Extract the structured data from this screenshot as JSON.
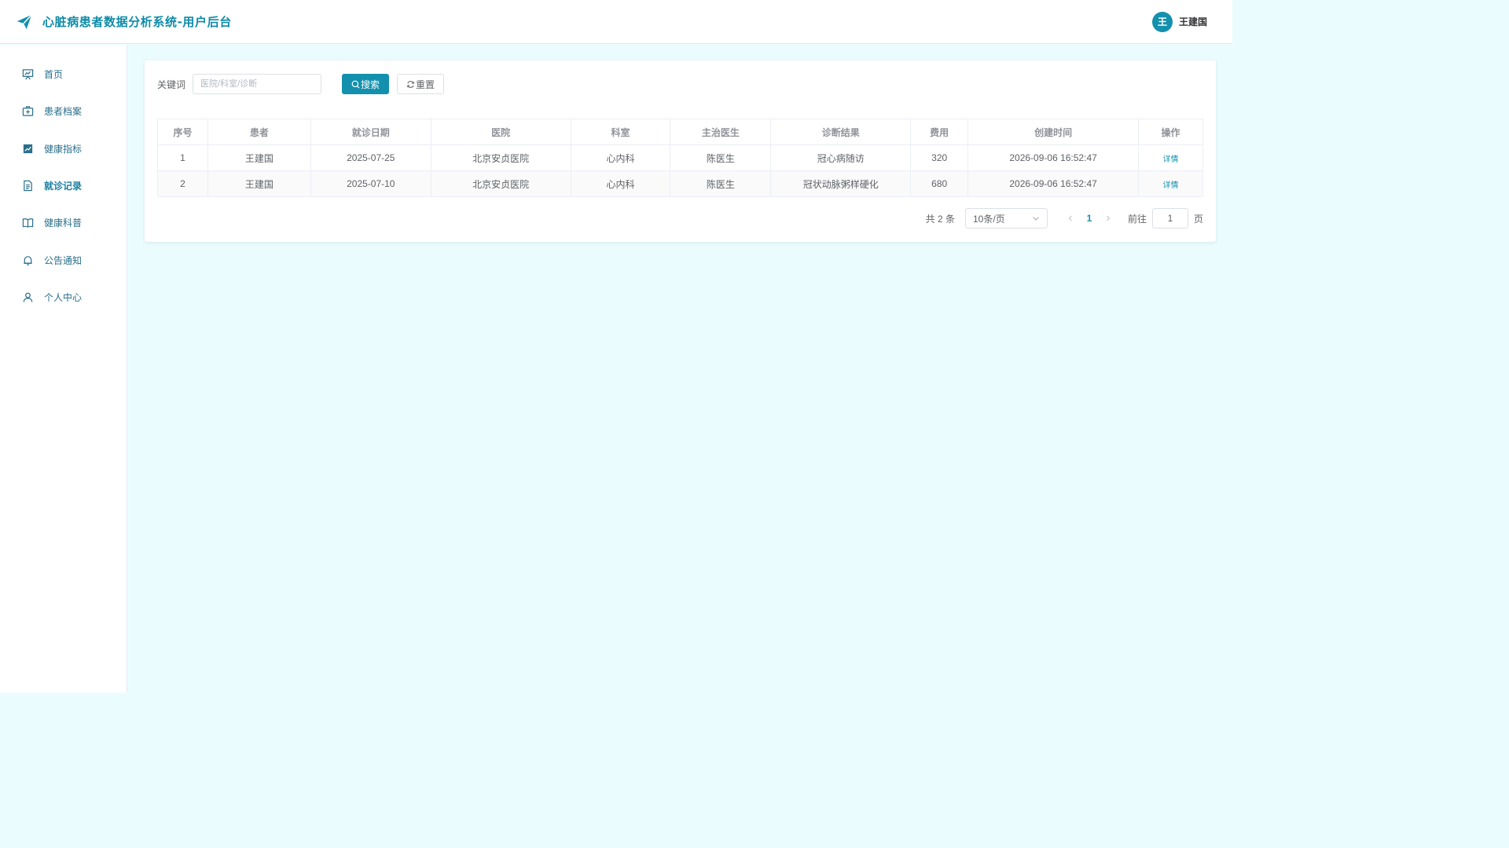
{
  "header": {
    "title": "心脏病患者数据分析系统-用户后台",
    "user": {
      "avatar_text": "王",
      "name": "王建国"
    }
  },
  "sidebar": {
    "items": [
      {
        "label": "首页",
        "icon": "presentation-chart-icon"
      },
      {
        "label": "患者档案",
        "icon": "medical-kit-icon"
      },
      {
        "label": "健康指标",
        "icon": "trend-chart-icon"
      },
      {
        "label": "就诊记录",
        "icon": "document-icon",
        "active": true
      },
      {
        "label": "健康科普",
        "icon": "open-book-icon"
      },
      {
        "label": "公告通知",
        "icon": "bell-icon"
      },
      {
        "label": "个人中心",
        "icon": "user-icon"
      }
    ]
  },
  "search": {
    "label": "关键词",
    "placeholder": "医院/科室/诊断",
    "value": "",
    "search_button": "搜索",
    "reset_button": "重置"
  },
  "table": {
    "columns": [
      "序号",
      "患者",
      "就诊日期",
      "医院",
      "科室",
      "主治医生",
      "诊断结果",
      "费用",
      "创建时间",
      "操作"
    ],
    "rows": [
      {
        "index": "1",
        "patient": "王建国",
        "visit_date": "2025-07-25",
        "hospital": "北京安贞医院",
        "department": "心内科",
        "doctor": "陈医生",
        "diagnosis": "冠心病随访",
        "cost": "320",
        "created_at": "2026-09-06 16:52:47",
        "action": "详情"
      },
      {
        "index": "2",
        "patient": "王建国",
        "visit_date": "2025-07-10",
        "hospital": "北京安贞医院",
        "department": "心内科",
        "doctor": "陈医生",
        "diagnosis": "冠状动脉粥样硬化",
        "cost": "680",
        "created_at": "2026-09-06 16:52:47",
        "action": "详情"
      }
    ]
  },
  "pagination": {
    "total_text": "共 2 条",
    "page_size": "10条/页",
    "current_page": "1",
    "goto_label": "前往",
    "goto_value": "1",
    "goto_suffix": "页"
  },
  "colors": {
    "primary": "#1390ad",
    "title": "#0f8ba7",
    "page_background": "#ebfcfe"
  }
}
